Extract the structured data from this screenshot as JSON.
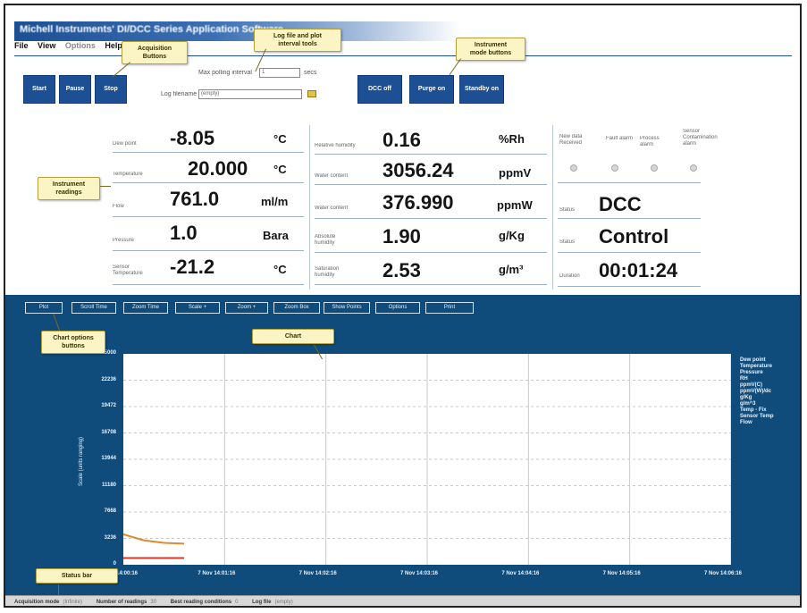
{
  "window": {
    "title": "Michell Instruments' DI/DCC Series Application Software",
    "menu": [
      "File",
      "View",
      "Options",
      "Help"
    ]
  },
  "toolbar": {
    "start_label": "Start",
    "pause_label": "Pause",
    "stop_label": "Stop",
    "log_interval_label": "Max polling interval",
    "log_interval_value": "1",
    "log_interval_unit": "secs",
    "log_filename_label": "Log filename",
    "log_filename_value": "(empty)",
    "dcc_off_label": "DCC off",
    "purge_on_label": "Purge on",
    "standby_on_label": "Standby on"
  },
  "callouts": {
    "acquisition": "Acquisition\nButtons",
    "logfile": "Log file and plot\ninterval tools",
    "instrument_mode": "Instrument\nmode buttons",
    "instrument_readings": "Instrument\nreadings",
    "chart_options": "Chart options\nbuttons",
    "chart": "Chart",
    "status_bar": "Status bar"
  },
  "readings": {
    "col1": [
      {
        "label": "Dew point",
        "value": "-8.05",
        "unit": "°C"
      },
      {
        "label": "Temperature",
        "value": "20.000",
        "unit": "°C"
      },
      {
        "label": "Flow",
        "value": "761.0",
        "unit": "ml/m"
      },
      {
        "label": "Pressure",
        "value": "1.0",
        "unit": "Bara"
      },
      {
        "label": "Sensor Temperature",
        "value": "-21.2",
        "unit": "°C"
      }
    ],
    "col2": [
      {
        "label": "Relative humidity",
        "value": "0.16",
        "unit": "%Rh"
      },
      {
        "label": "Water content",
        "value": "3056.24",
        "unit": "ppmV"
      },
      {
        "label": "Water content",
        "value": "376.990",
        "unit": "ppmW"
      },
      {
        "label": "Absolute humidity",
        "value": "1.90",
        "unit": "g/Kg"
      },
      {
        "label": "Saturation humidity",
        "value": "2.53",
        "unit": "g/m³"
      }
    ],
    "col3_indicators": [
      "New data Received",
      "Fault alarm",
      "Process alarm",
      "Sensor Contamination alarm"
    ],
    "col3": [
      {
        "label": "Status",
        "value": "DCC"
      },
      {
        "label": "Status",
        "value": "Control"
      },
      {
        "label": "Duration",
        "value": "00:01:24"
      }
    ]
  },
  "chart_buttons": [
    "Plot",
    "Scroll Time",
    "Zoom Time",
    "Scale +",
    "Zoom +",
    "Zoom Box",
    "Show Points",
    "Options",
    "Print"
  ],
  "chart_data": {
    "type": "line",
    "ylabel": "Scale (units ranging)",
    "y_ticks": [
      "25000",
      "22236",
      "19472",
      "16708",
      "13944",
      "11180",
      "7668",
      "3236",
      "0"
    ],
    "x_ticks": [
      "14:00:16",
      "7 Nov 14:01:16",
      "7 Nov 14:02:16",
      "7 Nov 14:03:16",
      "7 Nov 14:04:16",
      "7 Nov 14:05:16",
      "7 Nov 14:06:16"
    ],
    "legend": [
      "Dew point",
      "Temperature",
      "Pressure",
      "RH",
      "ppmV(C)",
      "ppmV(W)/dc",
      "g/Kg",
      "g/m^3",
      "Temp - Fix",
      "Sensor Temp",
      "Flow"
    ],
    "ylim": [
      0,
      25000
    ],
    "grid": true,
    "legend_position": "right",
    "series": [
      {
        "name": "Temperature",
        "color": "#e08a2a",
        "x": [
          0,
          0.2,
          0.4,
          0.6
        ],
        "y": [
          3600,
          2900,
          2600,
          2500
        ]
      },
      {
        "name": "Flow",
        "color": "#d43a2a",
        "x": [
          0,
          0.6
        ],
        "y": [
          800,
          800
        ]
      }
    ],
    "x_range": [
      0,
      6
    ]
  },
  "status": {
    "acq_label": "Acquisition mode",
    "acq_value": "(Infinite)",
    "num_label": "Number of readings",
    "num_value": "30",
    "best_label": "Best reading conditions",
    "best_value": "0",
    "log_label": "Log file",
    "log_value": "(empty)"
  }
}
